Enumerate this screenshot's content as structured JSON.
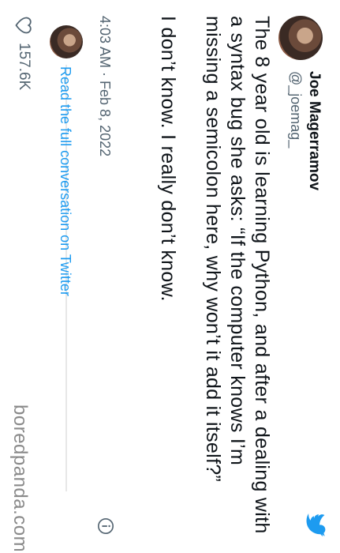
{
  "tweet": {
    "author_name": "Joe Magerramov",
    "author_handle": "@_joemag_",
    "paragraphs": [
      "The 8 year old is learning Python, and after a dealing with a syntax bug she asks: “If the computer knows I’m missing a semicolon here, why won’t it add it itself?”",
      "I don’t know. I really don’t know."
    ],
    "timestamp": "4:03 AM · Feb 8, 2022",
    "read_link": "Read the full conversation on Twitter",
    "like_count": "157.6K"
  },
  "watermark": "boredpanda.com",
  "colors": {
    "twitter_blue": "#1d9bf0",
    "text_primary": "#0f1419",
    "text_secondary": "#536471"
  },
  "icons": {
    "brand": "twitter-bird-icon",
    "info": "info-icon",
    "like": "heart-icon"
  }
}
